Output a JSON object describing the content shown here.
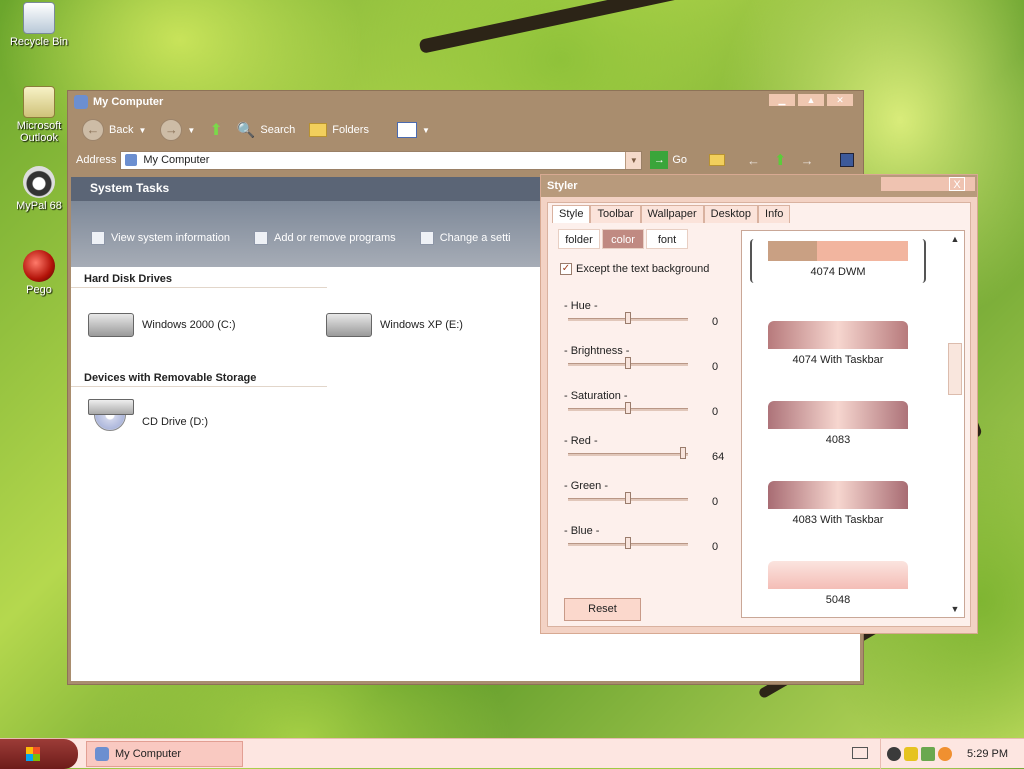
{
  "desktop": {
    "icons": [
      {
        "label": "Recycle Bin"
      },
      {
        "label": "Microsoft Outlook"
      },
      {
        "label": "MyPal 68"
      },
      {
        "label": "Pego"
      }
    ]
  },
  "explorer": {
    "title": "My Computer",
    "toolbar": {
      "back": "Back",
      "search": "Search",
      "folders": "Folders"
    },
    "address": {
      "label": "Address",
      "value": "My Computer",
      "go": "Go"
    },
    "system_tasks": {
      "heading": "System Tasks",
      "items": [
        "View system information",
        "Add or remove programs",
        "Change a setti"
      ]
    },
    "sections": [
      {
        "heading": "Hard Disk Drives",
        "items": [
          "Windows 2000 (C:)",
          "Windows XP (E:)"
        ]
      },
      {
        "heading": "Devices with Removable Storage",
        "items": [
          "CD Drive (D:)"
        ]
      }
    ]
  },
  "styler": {
    "title": "Styler",
    "close": "X",
    "tabs": [
      "Style",
      "Toolbar",
      "Wallpaper",
      "Desktop",
      "Info"
    ],
    "active_tab": "Style",
    "subtabs": [
      "folder",
      "color",
      "font"
    ],
    "active_subtab": "color",
    "except_label": "Except the text background",
    "except_checked": true,
    "sliders": [
      {
        "label": "- Hue -",
        "value": "0",
        "fraction": 0.5
      },
      {
        "label": "- Brightness -",
        "value": "0",
        "fraction": 0.5
      },
      {
        "label": "- Saturation -",
        "value": "0",
        "fraction": 0.5
      },
      {
        "label": "- Red -",
        "value": "64",
        "fraction": 0.96
      },
      {
        "label": "- Green -",
        "value": "0",
        "fraction": 0.5
      },
      {
        "label": "- Blue -",
        "value": "0",
        "fraction": 0.5
      }
    ],
    "reset": "Reset",
    "presets": [
      {
        "label": "4074 DWM",
        "color": "#c9a083",
        "selected": true
      },
      {
        "label": "4074 With Taskbar",
        "color": "#b77a7c"
      },
      {
        "label": "4083",
        "color": "#ad7379"
      },
      {
        "label": "4083 With Taskbar",
        "color": "#a86c73"
      },
      {
        "label": "5048",
        "color": "#f7c9c4"
      }
    ]
  },
  "taskbar": {
    "task_button": "My Computer",
    "clock": "5:29 PM"
  }
}
